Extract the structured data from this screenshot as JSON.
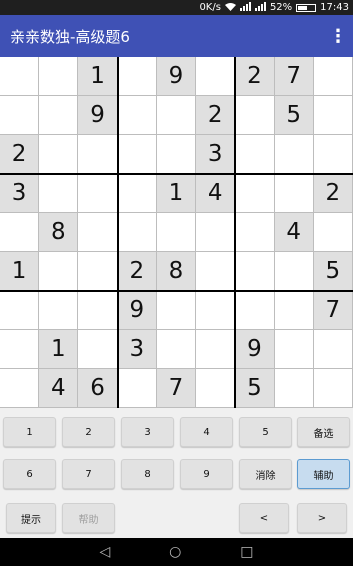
{
  "status": {
    "speed": "0K/s",
    "battery": "52%",
    "time": "17:43"
  },
  "app": {
    "title": "亲亲数独-高级题6",
    "menu_icon": "⋮"
  },
  "board": {
    "rows": [
      [
        "",
        "",
        "1",
        "",
        "9",
        "",
        "2",
        "7",
        ""
      ],
      [
        "",
        "",
        "9",
        "",
        "",
        "2",
        "",
        "5",
        ""
      ],
      [
        "2",
        "",
        "",
        "",
        "",
        "3",
        "",
        "",
        ""
      ],
      [
        "3",
        "",
        "",
        "",
        "1",
        "4",
        "",
        "",
        "2"
      ],
      [
        "",
        "8",
        "",
        "",
        "",
        "",
        "",
        "4",
        ""
      ],
      [
        "1",
        "",
        "",
        "2",
        "8",
        "",
        "",
        "",
        "5"
      ],
      [
        "",
        "",
        "",
        "9",
        "",
        "",
        "",
        "",
        "7"
      ],
      [
        "",
        "1",
        "",
        "3",
        "",
        "",
        "9",
        "",
        ""
      ],
      [
        "",
        "4",
        "6",
        "",
        "7",
        "",
        "5",
        "",
        ""
      ]
    ]
  },
  "keypad": {
    "row1": [
      "1",
      "2",
      "3",
      "4",
      "5",
      "备选"
    ],
    "row2": [
      "6",
      "7",
      "8",
      "9",
      "消除",
      "辅助"
    ],
    "row3": {
      "hint": "提示",
      "help": "帮助",
      "prev": "<",
      "next": ">"
    }
  },
  "nav": {
    "back": "◁",
    "home": "○",
    "recent": "□"
  }
}
